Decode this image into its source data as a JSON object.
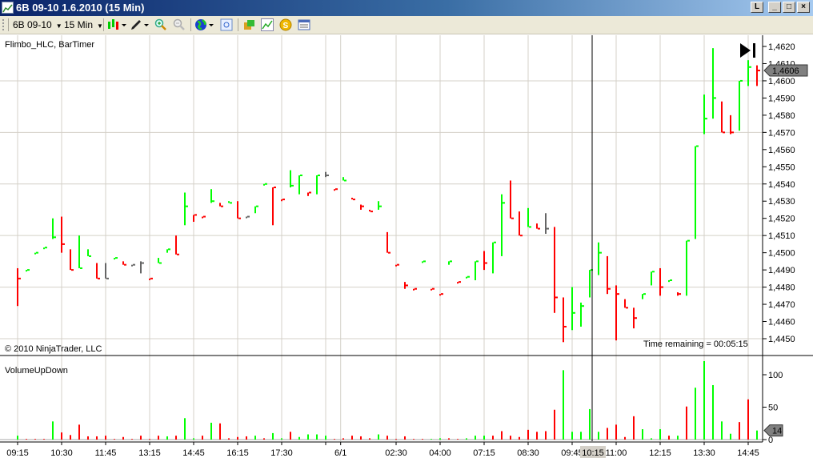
{
  "window": {
    "title": "6B 09-10  1.6.2010 (15 Min)",
    "btn_l": "L",
    "btn_min": "_",
    "btn_max": "□",
    "btn_close": "×"
  },
  "toolbar": {
    "instrument": "6B 09-10",
    "interval": "15 Min"
  },
  "panels": {
    "price_label": "Flimbo_HLC, BarTimer",
    "copyright": "© 2010 NinjaTrader, LLC",
    "time_remaining": "Time remaining = 00:05:15",
    "volume_label": "VolumeUpDown",
    "crosshair_time": "10:15"
  },
  "colors": {
    "up": "#00ff00",
    "down": "#ff0000",
    "neutral": "#666666",
    "grid": "#d4d0c8",
    "marker": "#808080"
  },
  "chart_data": [
    {
      "type": "hlc",
      "title": "6B 09-10 15 Min",
      "ylim": [
        1.445,
        1.462
      ],
      "yticks": [
        {
          "v": 1.462,
          "label": "1,4620"
        },
        {
          "v": 1.461,
          "label": "1,4610"
        },
        {
          "v": 1.46,
          "label": "1,4600"
        },
        {
          "v": 1.459,
          "label": "1,4590"
        },
        {
          "v": 1.458,
          "label": "1,4580"
        },
        {
          "v": 1.457,
          "label": "1,4570"
        },
        {
          "v": 1.456,
          "label": "1,4560"
        },
        {
          "v": 1.455,
          "label": "1,4550"
        },
        {
          "v": 1.454,
          "label": "1,4540"
        },
        {
          "v": 1.453,
          "label": "1,4530"
        },
        {
          "v": 1.452,
          "label": "1,4520"
        },
        {
          "v": 1.451,
          "label": "1,4510"
        },
        {
          "v": 1.45,
          "label": "1,4500"
        },
        {
          "v": 1.449,
          "label": "1,4490"
        },
        {
          "v": 1.448,
          "label": "1,4480"
        },
        {
          "v": 1.447,
          "label": "1,4470"
        },
        {
          "v": 1.446,
          "label": "1,4460"
        },
        {
          "v": 1.445,
          "label": "1,4450"
        }
      ],
      "hgrid": [
        1.445,
        1.448,
        1.451,
        1.454,
        1.457,
        1.46
      ],
      "last_price": {
        "v": 1.4606,
        "label": "1,4606"
      },
      "bars": [
        [
          1.4491,
          1.4469,
          1.4485,
          "r"
        ],
        [
          1.449,
          1.449,
          1.449,
          "g"
        ],
        [
          1.45,
          1.45,
          1.45,
          "g"
        ],
        [
          1.4503,
          1.4503,
          1.4503,
          "g"
        ],
        [
          1.452,
          1.4508,
          1.4509,
          "g"
        ],
        [
          1.4521,
          1.45,
          1.4505,
          "r"
        ],
        [
          1.4502,
          1.449,
          1.449,
          "r"
        ],
        [
          1.451,
          1.4491,
          1.4491,
          "g"
        ],
        [
          1.4502,
          1.4498,
          1.4498,
          "g"
        ],
        [
          1.4494,
          1.4485,
          1.4485,
          "r"
        ],
        [
          1.4494,
          1.4485,
          1.4485,
          "n"
        ],
        [
          1.4497,
          1.4497,
          1.4497,
          "g"
        ],
        [
          1.4495,
          1.4493,
          1.4493,
          "r"
        ],
        [
          1.4493,
          1.4493,
          1.4493,
          "n"
        ],
        [
          1.4495,
          1.4488,
          1.4494,
          "n"
        ],
        [
          1.4485,
          1.4485,
          1.4485,
          "r"
        ],
        [
          1.4497,
          1.4494,
          1.4494,
          "g"
        ],
        [
          1.4502,
          1.45,
          1.4502,
          "g"
        ],
        [
          1.451,
          1.4499,
          1.4499,
          "r"
        ],
        [
          1.4535,
          1.4516,
          1.4527,
          "g"
        ],
        [
          1.4522,
          1.4518,
          1.4522,
          "r"
        ],
        [
          1.4521,
          1.4521,
          1.4521,
          "r"
        ],
        [
          1.4537,
          1.4529,
          1.453,
          "g"
        ],
        [
          1.4529,
          1.4527,
          1.4527,
          "r"
        ],
        [
          1.453,
          1.4529,
          1.4529,
          "g"
        ],
        [
          1.453,
          1.452,
          1.452,
          "r"
        ],
        [
          1.4521,
          1.4521,
          1.4521,
          "n"
        ],
        [
          1.4527,
          1.4523,
          1.4527,
          "g"
        ],
        [
          1.454,
          1.454,
          1.454,
          "g"
        ],
        [
          1.4538,
          1.4516,
          1.4538,
          "r"
        ],
        [
          1.4531,
          1.453,
          1.4531,
          "r"
        ],
        [
          1.4548,
          1.4538,
          1.4539,
          "g"
        ],
        [
          1.4545,
          1.4534,
          1.4545,
          "g"
        ],
        [
          1.4535,
          1.4533,
          1.4535,
          "r"
        ],
        [
          1.4545,
          1.4534,
          1.4545,
          "g"
        ],
        [
          1.4547,
          1.4544,
          1.4545,
          "n"
        ],
        [
          1.4537,
          1.4537,
          1.4537,
          "r"
        ],
        [
          1.4544,
          1.4542,
          1.4542,
          "g"
        ],
        [
          1.4532,
          1.4531,
          1.4531,
          "r"
        ],
        [
          1.4528,
          1.4525,
          1.4527,
          "r"
        ],
        [
          1.4525,
          1.4524,
          1.4524,
          "r"
        ],
        [
          1.453,
          1.4525,
          1.4527,
          "g"
        ],
        [
          1.4512,
          1.45,
          1.45,
          "r"
        ],
        [
          1.4493,
          1.4493,
          1.4493,
          "r"
        ],
        [
          1.4483,
          1.4479,
          1.4481,
          "r"
        ],
        [
          1.4479,
          1.4479,
          1.4479,
          "r"
        ],
        [
          1.4495,
          1.4495,
          1.4495,
          "g"
        ],
        [
          1.4479,
          1.4479,
          1.4479,
          "r"
        ],
        [
          1.4476,
          1.4476,
          1.4476,
          "r"
        ],
        [
          1.4495,
          1.4493,
          1.4495,
          "g"
        ],
        [
          1.4483,
          1.4483,
          1.4483,
          "r"
        ],
        [
          1.4486,
          1.4486,
          1.4486,
          "g"
        ],
        [
          1.4495,
          1.4484,
          1.4495,
          "g"
        ],
        [
          1.4501,
          1.449,
          1.4494,
          "r"
        ],
        [
          1.4506,
          1.4488,
          1.4506,
          "g"
        ],
        [
          1.4534,
          1.4498,
          1.4529,
          "g"
        ],
        [
          1.4542,
          1.452,
          1.452,
          "r"
        ],
        [
          1.4524,
          1.451,
          1.451,
          "r"
        ],
        [
          1.4526,
          1.4515,
          1.4515,
          "g"
        ],
        [
          1.4517,
          1.4514,
          1.4514,
          "r"
        ],
        [
          1.4523,
          1.4511,
          1.4514,
          "n"
        ],
        [
          1.4515,
          1.4465,
          1.4474,
          "r"
        ],
        [
          1.4474,
          1.4448,
          1.4457,
          "r"
        ],
        [
          1.448,
          1.4455,
          1.4465,
          "g"
        ],
        [
          1.4471,
          1.4457,
          1.4469,
          "g"
        ],
        [
          1.449,
          1.4474,
          1.449,
          "g"
        ],
        [
          1.4506,
          1.4487,
          1.45,
          "g"
        ],
        [
          1.4498,
          1.4476,
          1.4479,
          "r"
        ],
        [
          1.4481,
          1.4449,
          1.4476,
          "r"
        ],
        [
          1.4473,
          1.4468,
          1.4468,
          "r"
        ],
        [
          1.4468,
          1.4456,
          1.4462,
          "r"
        ],
        [
          1.4476,
          1.4473,
          1.4476,
          "g"
        ],
        [
          1.4489,
          1.4481,
          1.4489,
          "g"
        ],
        [
          1.4491,
          1.4475,
          1.448,
          "r"
        ],
        [
          1.4484,
          1.4483,
          1.4484,
          "g"
        ],
        [
          1.4477,
          1.4475,
          1.4476,
          "r"
        ],
        [
          1.4507,
          1.4475,
          1.4507,
          "g"
        ],
        [
          1.4562,
          1.4508,
          1.4562,
          "g"
        ],
        [
          1.4592,
          1.4569,
          1.4578,
          "g"
        ],
        [
          1.4619,
          1.4578,
          1.459,
          "g"
        ],
        [
          1.4588,
          1.457,
          1.457,
          "r"
        ],
        [
          1.458,
          1.4569,
          1.457,
          "r"
        ],
        [
          1.46,
          1.4571,
          1.46,
          "g"
        ],
        [
          1.4612,
          1.4597,
          1.4608,
          "g"
        ],
        [
          1.4609,
          1.4597,
          1.4606,
          "r"
        ]
      ]
    },
    {
      "type": "bar",
      "title": "VolumeUpDown",
      "ylim": [
        0,
        120
      ],
      "yticks": [
        {
          "v": 0,
          "label": "0"
        },
        {
          "v": 50,
          "label": "50"
        },
        {
          "v": 100,
          "label": "100"
        }
      ],
      "last_value": {
        "v": 14,
        "label": "14"
      },
      "values": [
        6,
        1,
        1,
        1,
        28,
        11,
        7,
        23,
        5,
        5,
        6,
        1,
        4,
        1,
        6,
        1,
        6,
        5,
        6,
        33,
        2,
        6,
        26,
        25,
        2,
        4,
        5,
        6,
        2,
        10,
        2,
        12,
        4,
        8,
        8,
        6,
        1,
        2,
        6,
        5,
        2,
        8,
        6,
        1,
        5,
        1,
        1,
        1,
        2,
        2,
        1,
        2,
        6,
        6,
        6,
        13,
        6,
        4,
        15,
        12,
        13,
        46,
        107,
        12,
        12,
        47,
        12,
        18,
        23,
        4,
        36,
        16,
        2,
        16,
        6,
        6,
        51,
        80,
        121,
        84,
        28,
        9,
        27,
        62,
        14
      ],
      "colors": "gRRRgRRRRRRRRRRRRgRggRgRRRRgRggRggggRRRRRgRRRRRggRRgggRRRRRRRRgggggRRRRgggRgRgggggRRggR"
    }
  ],
  "xaxis": {
    "labels": [
      {
        "i": 0,
        "label": "09:15"
      },
      {
        "i": 5,
        "label": "10:30"
      },
      {
        "i": 10,
        "label": "11:45"
      },
      {
        "i": 15,
        "label": "13:15"
      },
      {
        "i": 20,
        "label": "14:45"
      },
      {
        "i": 25,
        "label": "16:15"
      },
      {
        "i": 30,
        "label": "17:30"
      },
      {
        "i": 36.7,
        "label": "6/1"
      },
      {
        "i": 43,
        "label": "02:30"
      },
      {
        "i": 48,
        "label": "04:00"
      },
      {
        "i": 53,
        "label": "07:15"
      },
      {
        "i": 58,
        "label": "08:30"
      },
      {
        "i": 63,
        "label": "09:45"
      },
      {
        "i": 68,
        "label": "11:00"
      },
      {
        "i": 73,
        "label": "12:15"
      },
      {
        "i": 78,
        "label": "13:30"
      },
      {
        "i": 83,
        "label": "14:45"
      }
    ],
    "extra_grid": [
      35
    ]
  }
}
